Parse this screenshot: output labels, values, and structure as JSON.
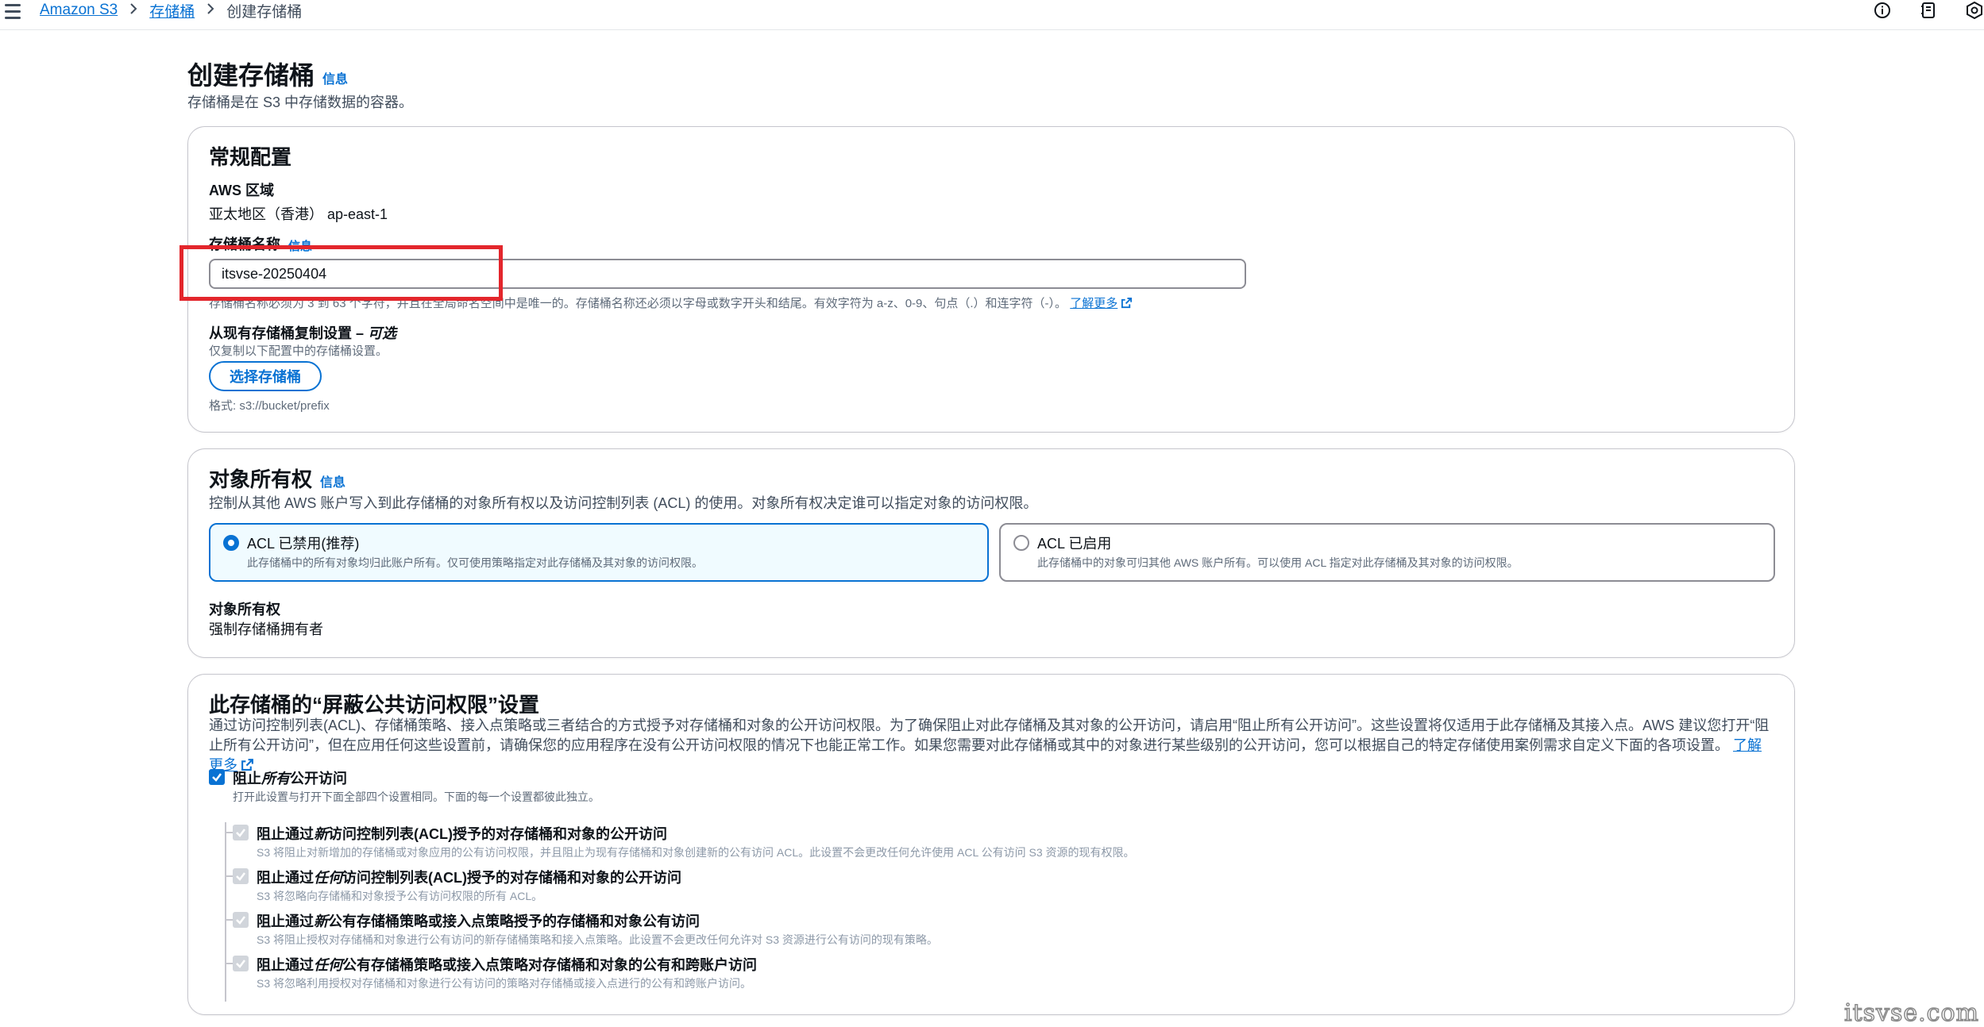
{
  "breadcrumb": {
    "root": "Amazon S3",
    "buckets": "存储桶",
    "current": "创建存储桶"
  },
  "header": {
    "title": "创建存储桶",
    "info": "信息",
    "description": "存储桶是在 S3 中存储数据的容器。"
  },
  "general": {
    "title": "常规配置",
    "region_label": "AWS 区域",
    "region_value": "亚太地区（香港） ap-east-1",
    "bucket_name_label": "存储桶名称",
    "bucket_name_info": "信息",
    "bucket_name_value": "itsvse-20250404",
    "bucket_name_hint": "存储桶名称必须为 3 到 63 个字符，并且在全局命名空间中是唯一的。存储桶名称还必须以字母或数字开头和结尾。有效字符为 a-z、0-9、句点（.）和连字符（-）。",
    "learn_more": "了解更多",
    "copy_label": "从现有存储桶复制设置 – ",
    "copy_optional": "可选",
    "copy_desc": "仅复制以下配置中的存储桶设置。",
    "choose_bucket": "选择存储桶",
    "format_hint": "格式: s3://bucket/prefix"
  },
  "ownership": {
    "title": "对象所有权",
    "info": "信息",
    "description": "控制从其他 AWS 账户写入到此存储桶的对象所有权以及访问控制列表 (ACL) 的使用。对象所有权决定谁可以指定对象的访问权限。",
    "option_disabled_title": "ACL 已禁用(推荐)",
    "option_disabled_desc": "此存储桶中的所有对象均归此账户所有。仅可使用策略指定对此存储桶及其对象的访问权限。",
    "option_enabled_title": "ACL 已启用",
    "option_enabled_desc": "此存储桶中的对象可归其他 AWS 账户所有。可以使用 ACL 指定对此存储桶及其对象的访问权限。",
    "ownership_label": "对象所有权",
    "ownership_value": "强制存储桶拥有者"
  },
  "block": {
    "title": "此存储桶的“屏蔽公共访问权限”设置",
    "description": "通过访问控制列表(ACL)、存储桶策略、接入点策略或三者结合的方式授予对存储桶和对象的公开访问权限。为了确保阻止对此存储桶及其对象的公开访问，请启用“阻止所有公开访问”。这些设置将仅适用于此存储桶及其接入点。AWS 建议您打开“阻止所有公开访问”，但在应用任何这些设置前，请确保您的应用程序在没有公开访问权限的情况下也能正常工作。如果您需要对此存储桶或其中的对象进行某些级别的公开访问，您可以根据自己的特定存储使用案例需求自定义下面的各项设置。",
    "learn_more": "了解更多",
    "all_pre": "阻止",
    "all_em": "所有",
    "all_post": "公开访问",
    "all_desc": "打开此设置与打开下面全部四个设置相同。下面的每一个设置都彼此独立。",
    "items": [
      {
        "pre": "阻止通过",
        "em": "新",
        "post": "访问控制列表(ACL)授予的对存储桶和对象的公开访问",
        "desc": "S3 将阻止对新增加的存储桶或对象应用的公有访问权限，并且阻止为现有存储桶和对象创建新的公有访问 ACL。此设置不会更改任何允许使用 ACL 公有访问 S3 资源的现有权限。"
      },
      {
        "pre": "阻止通过",
        "em": "任何",
        "post": "访问控制列表(ACL)授予的对存储桶和对象的公开访问",
        "desc": "S3 将忽略向存储桶和对象授予公有访问权限的所有 ACL。"
      },
      {
        "pre": "阻止通过",
        "em": "新",
        "post": "公有存储桶策略或接入点策略授予的存储桶和对象公有访问",
        "desc": "S3 将阻止授权对存储桶和对象进行公有访问的新存储桶策略和接入点策略。此设置不会更改任何允许对 S3 资源进行公有访问的现有策略。"
      },
      {
        "pre": "阻止通过",
        "em": "任何",
        "post": "公有存储桶策略或接入点策略对存储桶和对象的公有和跨账户访问",
        "desc": "S3 将忽略利用授权对存储桶和对象进行公有访问的策略对存储桶或接入点进行的公有和跨账户访问。"
      }
    ]
  },
  "watermark": "itsvse.com",
  "icons": [
    "menu-icon",
    "chevron-right-icon",
    "info-circle-icon",
    "notes-icon",
    "settings-icon",
    "external-link-icon",
    "check-icon"
  ]
}
